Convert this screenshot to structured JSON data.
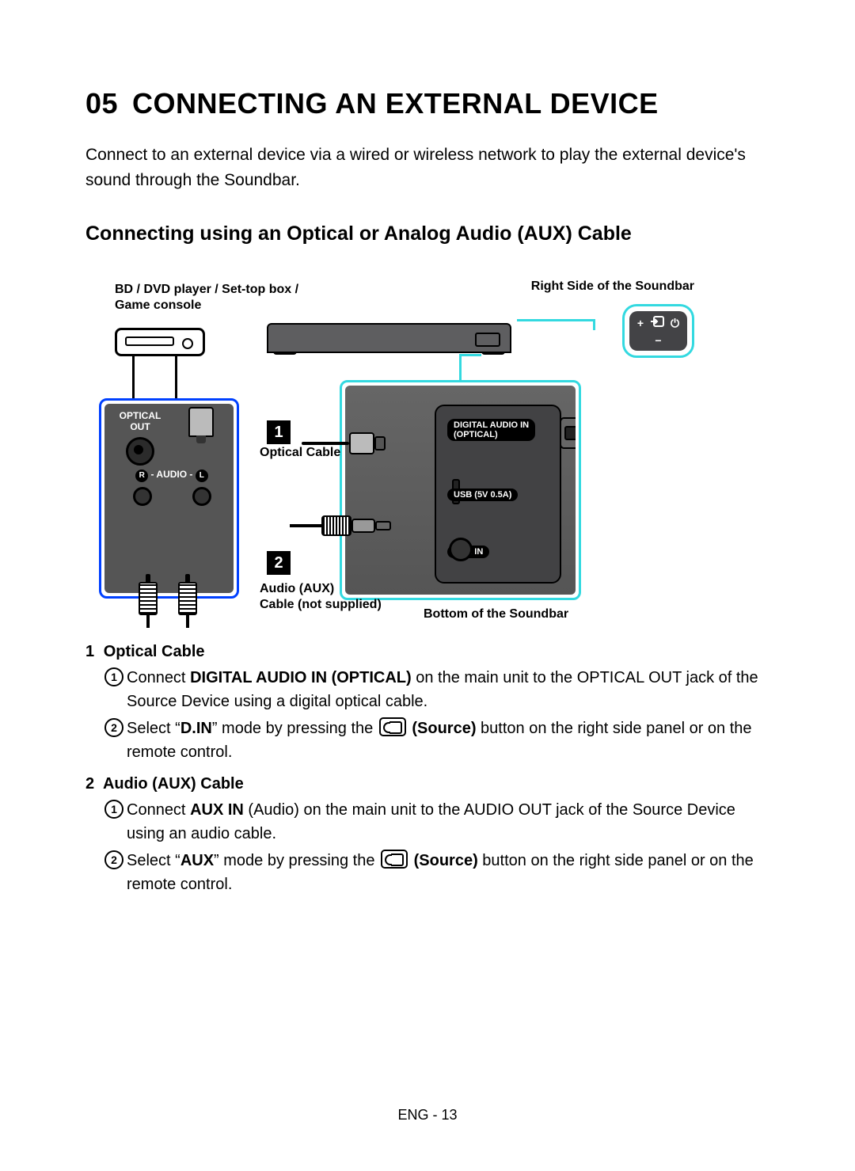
{
  "section": {
    "number": "05",
    "title": "CONNECTING AN EXTERNAL DEVICE"
  },
  "intro": "Connect to an external device via a wired or wireless network to play the external device's sound through the Soundbar.",
  "subheading": "Connecting using an Optical or Analog Audio (AUX) Cable",
  "diagram": {
    "source_device_label": "BD / DVD player / Set-top box / Game console",
    "right_side_label": "Right Side of the Soundbar",
    "optical_cable_label": "Optical Cable",
    "aux_cable_label_line1": "Audio (AUX)",
    "aux_cable_label_line2": "Cable (not supplied)",
    "bottom_label": "Bottom of the Soundbar",
    "control_panel": {
      "plus": "+",
      "minus": "−",
      "power_icon": "⏻"
    },
    "source_ports": {
      "optical_out": "OPTICAL OUT",
      "audio_r": "R",
      "audio_label": "- AUDIO -",
      "audio_l": "L"
    },
    "soundbar_ports": {
      "digital_in_line1": "DIGITAL AUDIO IN",
      "digital_in_line2": "(OPTICAL)",
      "usb": "USB (5V 0.5A)",
      "aux_in": "AUX IN"
    },
    "badge1": "1",
    "badge2": "2"
  },
  "steps": {
    "s1": {
      "idx": "1",
      "title": "Optical Cable",
      "b1_pre": "Connect ",
      "b1_bold": "DIGITAL AUDIO IN (OPTICAL)",
      "b1_post": " on the main unit to the OPTICAL OUT jack of the Source Device using a digital optical cable.",
      "b2_pre": "Select “",
      "b2_bold1": "D.IN",
      "b2_mid": "” mode by pressing the ",
      "b2_bold2": "(Source)",
      "b2_post": " button on the right side panel or on the remote control."
    },
    "s2": {
      "idx": "2",
      "title": "Audio (AUX) Cable",
      "b1_pre": "Connect ",
      "b1_bold": "AUX IN",
      "b1_post": " (Audio) on the main unit to the AUDIO OUT jack of the Source Device using an audio cable.",
      "b2_pre": "Select “",
      "b2_bold1": "AUX",
      "b2_mid": "” mode by pressing the ",
      "b2_bold2": "(Source)",
      "b2_post": " button on the right side panel or on the remote control."
    }
  },
  "footer": "ENG - 13"
}
